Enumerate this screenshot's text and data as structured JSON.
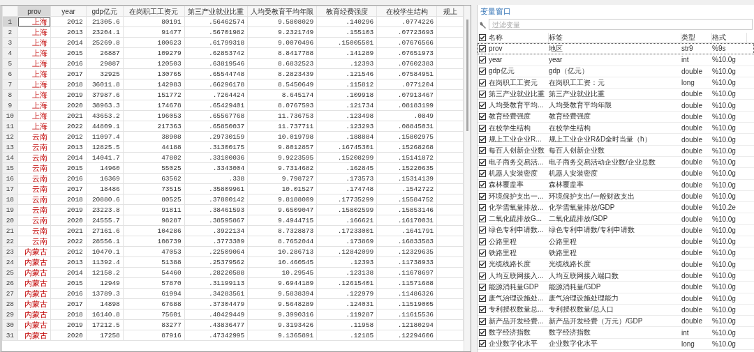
{
  "data_editor": {
    "columns": [
      {
        "label": "prov",
        "kind": "string",
        "selected": true
      },
      {
        "label": "year",
        "kind": "numeric",
        "selected": false
      },
      {
        "label": "gdp亿元",
        "kind": "numeric",
        "selected": false
      },
      {
        "label": "在岗职工工资元",
        "kind": "numeric",
        "selected": false
      },
      {
        "label": "第三产业就业比重",
        "kind": "numeric",
        "selected": false
      },
      {
        "label": "人均受教育平均年限",
        "kind": "numeric",
        "selected": false
      },
      {
        "label": "教育经费强度",
        "kind": "numeric",
        "selected": false
      },
      {
        "label": "在校学生结构",
        "kind": "numeric",
        "selected": false
      },
      {
        "label": "规上",
        "kind": "numeric",
        "selected": false
      }
    ],
    "rows": [
      {
        "n": "1",
        "selected": true,
        "cells": [
          "上海",
          "2012",
          "21305.6",
          "80191",
          ".56462574",
          "9.5808029",
          ".140296",
          ".0774226"
        ]
      },
      {
        "n": "2",
        "selected": false,
        "cells": [
          "上海",
          "2013",
          "23204.1",
          "91477",
          ".56701982",
          "9.2321749",
          ".155103",
          ".07723693"
        ]
      },
      {
        "n": "3",
        "selected": false,
        "cells": [
          "上海",
          "2014",
          "25269.8",
          "100623",
          ".61799318",
          "9.0070496",
          ".15005501",
          ".07676566"
        ]
      },
      {
        "n": "4",
        "selected": false,
        "cells": [
          "上海",
          "2015",
          "26887",
          "109279",
          ".62853742",
          "8.8417788",
          ".141289",
          ".07651973"
        ]
      },
      {
        "n": "5",
        "selected": false,
        "cells": [
          "上海",
          "2016",
          "29887",
          "120503",
          ".63819546",
          "8.6832523",
          ".12393",
          ".07602383"
        ]
      },
      {
        "n": "6",
        "selected": false,
        "cells": [
          "上海",
          "2017",
          "32925",
          "130765",
          ".65544748",
          "8.2823439",
          ".121546",
          ".07584951"
        ]
      },
      {
        "n": "7",
        "selected": false,
        "cells": [
          "上海",
          "2018",
          "36011.8",
          "142983",
          ".66296178",
          "8.5450649",
          ".115812",
          ".0771204"
        ]
      },
      {
        "n": "8",
        "selected": false,
        "cells": [
          "上海",
          "2019",
          "37987.6",
          "151772",
          ".7264424",
          "8.645174",
          ".109918",
          ".07913467"
        ]
      },
      {
        "n": "9",
        "selected": false,
        "cells": [
          "上海",
          "2020",
          "38963.3",
          "174678",
          ".65429401",
          "8.0767593",
          ".121734",
          ".08183199"
        ]
      },
      {
        "n": "10",
        "selected": false,
        "cells": [
          "上海",
          "2021",
          "43653.2",
          "196053",
          ".65567768",
          "11.736753",
          ".123498",
          ".0849"
        ]
      },
      {
        "n": "11",
        "selected": false,
        "cells": [
          "上海",
          "2022",
          "44809.1",
          "217363",
          ".65850037",
          "11.737711",
          ".123293",
          ".08845031"
        ]
      },
      {
        "n": "12",
        "selected": false,
        "cells": [
          "云南",
          "2012",
          "11097.4",
          "38908",
          ".29730159",
          "10.019798",
          ".188884",
          ".15802975"
        ]
      },
      {
        "n": "13",
        "selected": false,
        "cells": [
          "云南",
          "2013",
          "12825.5",
          "44188",
          ".31300175",
          "9.8012857",
          ".16745301",
          ".15268268"
        ]
      },
      {
        "n": "14",
        "selected": false,
        "cells": [
          "云南",
          "2014",
          "14041.7",
          "47802",
          ".33100036",
          "9.9223595",
          ".15208299",
          ".15141872"
        ]
      },
      {
        "n": "15",
        "selected": false,
        "cells": [
          "云南",
          "2015",
          "14960",
          "55025",
          ".3343004",
          "9.7314682",
          ".162845",
          ".15220635"
        ]
      },
      {
        "n": "16",
        "selected": false,
        "cells": [
          "云南",
          "2016",
          "16369",
          "63562",
          ".338",
          "9.798727",
          ".173573",
          ".15314139"
        ]
      },
      {
        "n": "17",
        "selected": false,
        "cells": [
          "云南",
          "2017",
          "18486",
          "73515",
          ".35809961",
          "10.01527",
          ".174748",
          ".1542722"
        ]
      },
      {
        "n": "18",
        "selected": false,
        "cells": [
          "云南",
          "2018",
          "20880.6",
          "80525",
          ".37800142",
          "9.8188009",
          ".17735299",
          ".15584752"
        ]
      },
      {
        "n": "19",
        "selected": false,
        "cells": [
          "云南",
          "2019",
          "23223.8",
          "91811",
          ".38461593",
          "9.6509047",
          ".15802599",
          ".15853146"
        ]
      },
      {
        "n": "20",
        "selected": false,
        "cells": [
          "云南",
          "2020",
          "24555.7",
          "98287",
          ".38595867",
          "9.4944715",
          ".166621",
          ".16170031"
        ]
      },
      {
        "n": "21",
        "selected": false,
        "cells": [
          "云南",
          "2021",
          "27161.6",
          "104286",
          ".3922134",
          "8.7328873",
          ".17233001",
          ".1641791"
        ]
      },
      {
        "n": "22",
        "selected": false,
        "cells": [
          "云南",
          "2022",
          "28556.1",
          "108739",
          ".3773309",
          "8.7652044",
          ".173869",
          ".16833583"
        ]
      },
      {
        "n": "23",
        "selected": false,
        "cells": [
          "内蒙古",
          "2012",
          "10470.1",
          "47053",
          ".22509064",
          "10.286713",
          ".12842099",
          ".12329635"
        ]
      },
      {
        "n": "24",
        "selected": false,
        "cells": [
          "内蒙古",
          "2013",
          "11392.4",
          "51388",
          ".25379562",
          "10.460545",
          ".12393",
          ".11738933"
        ]
      },
      {
        "n": "25",
        "selected": false,
        "cells": [
          "内蒙古",
          "2014",
          "12158.2",
          "54460",
          ".28220588",
          "10.29545",
          ".123138",
          ".11678697"
        ]
      },
      {
        "n": "26",
        "selected": false,
        "cells": [
          "内蒙古",
          "2015",
          "12949",
          "57870",
          ".31199113",
          "9.6944189",
          ".12615401",
          ".11571688"
        ]
      },
      {
        "n": "27",
        "selected": false,
        "cells": [
          "内蒙古",
          "2016",
          "13789.3",
          "61994",
          ".34283561",
          "9.5838394",
          ".122979",
          ".11486326"
        ]
      },
      {
        "n": "28",
        "selected": false,
        "cells": [
          "内蒙古",
          "2017",
          "14898",
          "67688",
          ".37304479",
          "9.5648289",
          ".124031",
          ".11519005"
        ]
      },
      {
        "n": "29",
        "selected": false,
        "cells": [
          "内蒙古",
          "2018",
          "16140.8",
          "75601",
          ".40429449",
          "9.3990316",
          ".119287",
          ".11615536"
        ]
      },
      {
        "n": "30",
        "selected": false,
        "cells": [
          "内蒙古",
          "2019",
          "17212.5",
          "83277",
          ".43836477",
          "9.3193426",
          ".11958",
          ".12180294"
        ]
      },
      {
        "n": "31",
        "selected": false,
        "cells": [
          "内蒙古",
          "2020",
          "17258",
          "87916",
          ".47342995",
          "9.1365891",
          ".12185",
          ".12294606"
        ]
      }
    ]
  },
  "variables_window": {
    "title": "变量窗口",
    "filter": {
      "placeholder": "过滤变量"
    },
    "header": {
      "checked": true,
      "columns": [
        "名称",
        "标签",
        "类型",
        "格式"
      ]
    },
    "variables": [
      {
        "checked": true,
        "selected": true,
        "name": "prov",
        "label": "地区",
        "type": "str9",
        "format": "%9s"
      },
      {
        "checked": true,
        "selected": false,
        "name": "year",
        "label": "year",
        "type": "int",
        "format": "%10.0g"
      },
      {
        "checked": true,
        "selected": false,
        "name": "gdp亿元",
        "label": "gdp（亿元）",
        "type": "double",
        "format": "%10.0g"
      },
      {
        "checked": true,
        "selected": false,
        "name": "在岗职工工资元",
        "label": "在岗职工工资：元",
        "type": "long",
        "format": "%10.0g"
      },
      {
        "checked": true,
        "selected": false,
        "name": "第三产业就业比重",
        "label": "第三产业就业比重",
        "type": "double",
        "format": "%10.0g"
      },
      {
        "checked": true,
        "selected": false,
        "name": "人均受教育平均...",
        "label": "人均受教育平均年限",
        "type": "double",
        "format": "%10.0g"
      },
      {
        "checked": true,
        "selected": false,
        "name": "教育经费强度",
        "label": "教育经费强度",
        "type": "double",
        "format": "%10.0g"
      },
      {
        "checked": true,
        "selected": false,
        "name": "在校学生结构",
        "label": "在校学生结构",
        "type": "double",
        "format": "%10.0g"
      },
      {
        "checked": true,
        "selected": false,
        "name": "规上工业企业R...",
        "label": "规上工业企业R&D全时当量（h）",
        "type": "double",
        "format": "%10.0g"
      },
      {
        "checked": true,
        "selected": false,
        "name": "每百人创新企业数",
        "label": "每百人创新企业数",
        "type": "double",
        "format": "%10.0g"
      },
      {
        "checked": true,
        "selected": false,
        "name": "电子商务交易活...",
        "label": "电子商务交易活动企业数/企业总数",
        "type": "double",
        "format": "%10.0g"
      },
      {
        "checked": true,
        "selected": false,
        "name": "机器人安装密度",
        "label": "机器人安装密度",
        "type": "double",
        "format": "%10.0g"
      },
      {
        "checked": true,
        "selected": false,
        "name": "森林覆盖率",
        "label": "森林覆盖率",
        "type": "double",
        "format": "%10.0g"
      },
      {
        "checked": true,
        "selected": false,
        "name": "环境保护支出一...",
        "label": "环境保护支出/一般财政支出",
        "type": "double",
        "format": "%10.0g"
      },
      {
        "checked": true,
        "selected": false,
        "name": "化学需氧量排放...",
        "label": "化学需氧量排放/GDP",
        "type": "double",
        "format": "%10.2e"
      },
      {
        "checked": true,
        "selected": false,
        "name": "二氧化硫排放G...",
        "label": "二氧化硫排放/GDP",
        "type": "double",
        "format": "%10.0g"
      },
      {
        "checked": true,
        "selected": false,
        "name": "绿色专利申请数...",
        "label": "绿色专利申请数/专利申请数",
        "type": "double",
        "format": "%10.0g"
      },
      {
        "checked": true,
        "selected": false,
        "name": "公路里程",
        "label": "公路里程",
        "type": "double",
        "format": "%10.0g"
      },
      {
        "checked": true,
        "selected": false,
        "name": "铁路里程",
        "label": "铁路里程",
        "type": "double",
        "format": "%10.0g"
      },
      {
        "checked": true,
        "selected": false,
        "name": "光缆线路长度",
        "label": "光缆线路长度",
        "type": "double",
        "format": "%10.0g"
      },
      {
        "checked": true,
        "selected": false,
        "name": "人均互联网接入...",
        "label": "人均互联网接入端口数",
        "type": "double",
        "format": "%10.0g"
      },
      {
        "checked": true,
        "selected": false,
        "name": "能源消耗量GDP",
        "label": "能源消耗量/GDP",
        "type": "double",
        "format": "%10.0g"
      },
      {
        "checked": true,
        "selected": false,
        "name": "废气治理设施处...",
        "label": "废气治理设施处理能力",
        "type": "double",
        "format": "%10.0g"
      },
      {
        "checked": true,
        "selected": false,
        "name": "专利授权数量总...",
        "label": "专利授权数量/总人口",
        "type": "double",
        "format": "%10.0g"
      },
      {
        "checked": true,
        "selected": false,
        "name": "新产品开发经费...",
        "label": "新产品开发经费（万元）/GDP",
        "type": "double",
        "format": "%10.0g"
      },
      {
        "checked": true,
        "selected": false,
        "name": "数字经济指数",
        "label": "数字经济指数",
        "type": "int",
        "format": "%10.0g"
      },
      {
        "checked": true,
        "selected": false,
        "name": "企业数字化水平",
        "label": "企业数字化水平",
        "type": "long",
        "format": "%10.0g"
      }
    ]
  }
}
